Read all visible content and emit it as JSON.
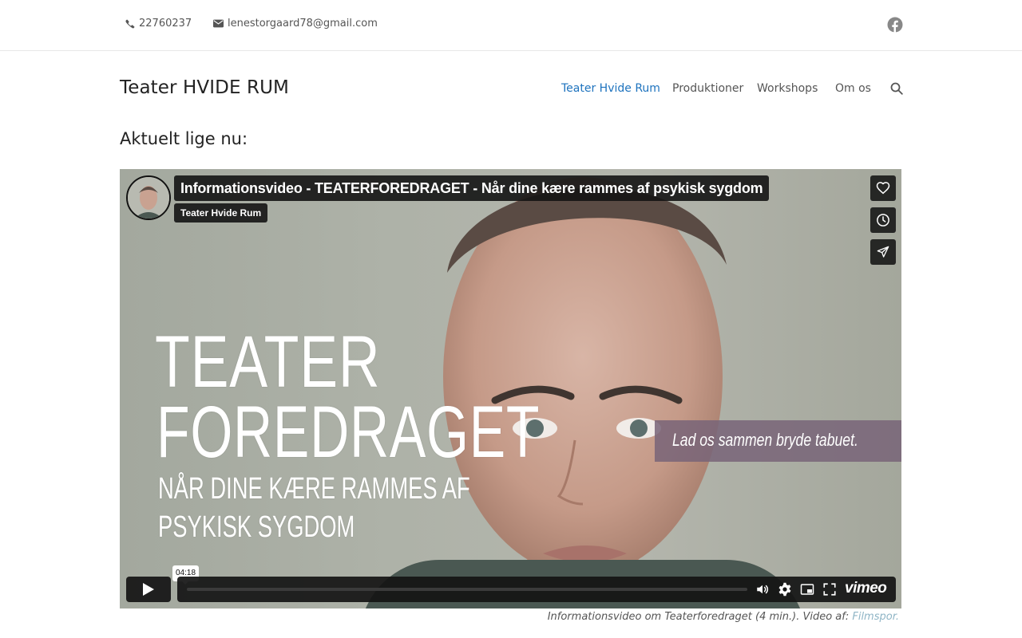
{
  "topbar": {
    "phone": "22760237",
    "email": "lenestorgaard78@gmail.com",
    "social_icon": "facebook-icon"
  },
  "header": {
    "brand": "Teater HVIDE RUM",
    "nav": [
      {
        "label": "Teater Hvide Rum",
        "active": true
      },
      {
        "label": "Produktioner",
        "active": false
      },
      {
        "label": "Workshops",
        "active": false
      },
      {
        "label": "Om os",
        "active": false
      }
    ],
    "search_icon": "search-icon"
  },
  "main": {
    "section_title": "Aktuelt lige nu:"
  },
  "video": {
    "title": "Informationsvideo - TEATERFOREDRAGET - Når dine kære rammes af psykisk sygdom",
    "channel": "Teater Hvide Rum",
    "poster_lines": [
      "TEATER",
      "FOREDRAGET",
      "NÅR DINE KÆRE RAMMES AF",
      "PSYKISK SYGDOM"
    ],
    "tagline": "Lad os sammen bryde tabuet.",
    "duration": "04:18",
    "progress": 0,
    "logo": "vimeo",
    "side_buttons": [
      "like-icon",
      "watch-later-icon",
      "share-icon"
    ],
    "controls": [
      "play-icon",
      "volume-icon",
      "settings-icon",
      "picture-in-picture-icon",
      "fullscreen-icon"
    ]
  },
  "caption": {
    "text": "Informationsvideo om Teaterforedraget (4 min.). Video af: ",
    "link": "Filmspor."
  },
  "colors": {
    "accent": "#1e73be",
    "link_muted": "#8fb5c6",
    "player_bg": "#141414"
  }
}
